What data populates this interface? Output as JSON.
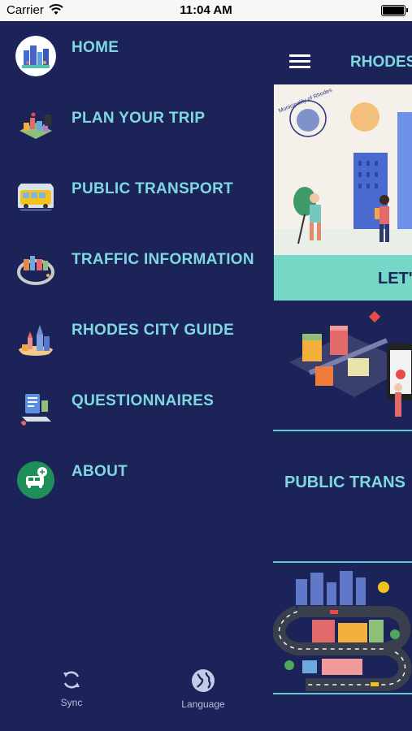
{
  "status_bar": {
    "carrier": "Carrier",
    "time": "11:04 AM"
  },
  "drawer": {
    "items": [
      {
        "label": "HOME",
        "icon": "home-icon"
      },
      {
        "label": "PLAN YOUR TRIP",
        "icon": "plan-trip-icon"
      },
      {
        "label": "PUBLIC TRANSPORT",
        "icon": "bus-icon"
      },
      {
        "label": "TRAFFIC INFORMATION",
        "icon": "traffic-icon"
      },
      {
        "label": "RHODES CITY GUIDE",
        "icon": "city-guide-icon"
      },
      {
        "label": "QUESTIONNAIRES",
        "icon": "questionnaire-icon"
      },
      {
        "label": "ABOUT",
        "icon": "about-icon"
      }
    ],
    "footer": {
      "sync_label": "Sync",
      "language_label": "Language"
    }
  },
  "main": {
    "title": "RHODES",
    "hero": {
      "seal_text": "Municipality of Rhodes",
      "cta_text": "LET'"
    },
    "public_transport_title": "PUBLIC TRANS"
  },
  "colors": {
    "background": "#1b2358",
    "accent": "#7fd8e0",
    "divider": "#64c6d0",
    "hero_band": "#75d7c6"
  }
}
